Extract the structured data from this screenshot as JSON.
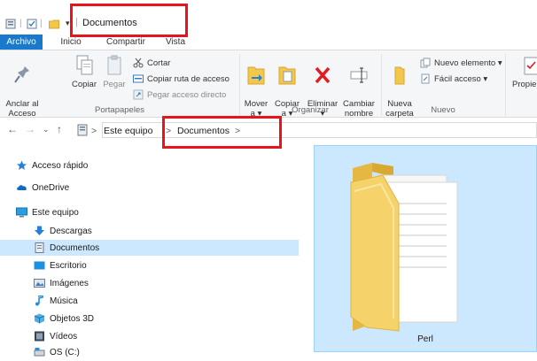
{
  "window": {
    "title": "Documentos"
  },
  "tabs": [
    {
      "label": "Archivo"
    },
    {
      "label": "Inicio"
    },
    {
      "label": "Compartir"
    },
    {
      "label": "Vista"
    }
  ],
  "ribbon": {
    "portapapeles": {
      "label": "Portapapeles",
      "anclar": "Anclar al\nAcceso rápido",
      "copiar": "Copiar",
      "pegar": "Pegar",
      "cortar": "Cortar",
      "copiar_ruta": "Copiar ruta de acceso",
      "pegar_directo": "Pegar acceso directo"
    },
    "organizar": {
      "label": "Organizar",
      "mover": "Mover\na ▾",
      "copiar_a": "Copiar\na ▾",
      "eliminar": "Eliminar\n▾",
      "cambiar": "Cambiar\nnombre"
    },
    "nuevo": {
      "label": "Nuevo",
      "nueva_carpeta": "Nueva\ncarpeta",
      "nuevo_elemento": "Nuevo elemento ▾",
      "facil_acceso": "Fácil acceso ▾"
    },
    "propiedades": "Propie"
  },
  "address": {
    "crumbs": [
      "Este equipo",
      "Documentos"
    ],
    "sep": ">"
  },
  "nav": {
    "acceso_rapido": "Acceso rápido",
    "onedrive": "OneDrive",
    "este_equipo": "Este equipo",
    "items": [
      "Descargas",
      "Documentos",
      "Escritorio",
      "Imágenes",
      "Música",
      "Objetos 3D",
      "Vídeos",
      "OS (C:)"
    ]
  },
  "content": {
    "folder": "Perl"
  },
  "colors": {
    "accent": "#1979ca",
    "selection": "#cce8ff",
    "highlight": "#e8141b"
  }
}
